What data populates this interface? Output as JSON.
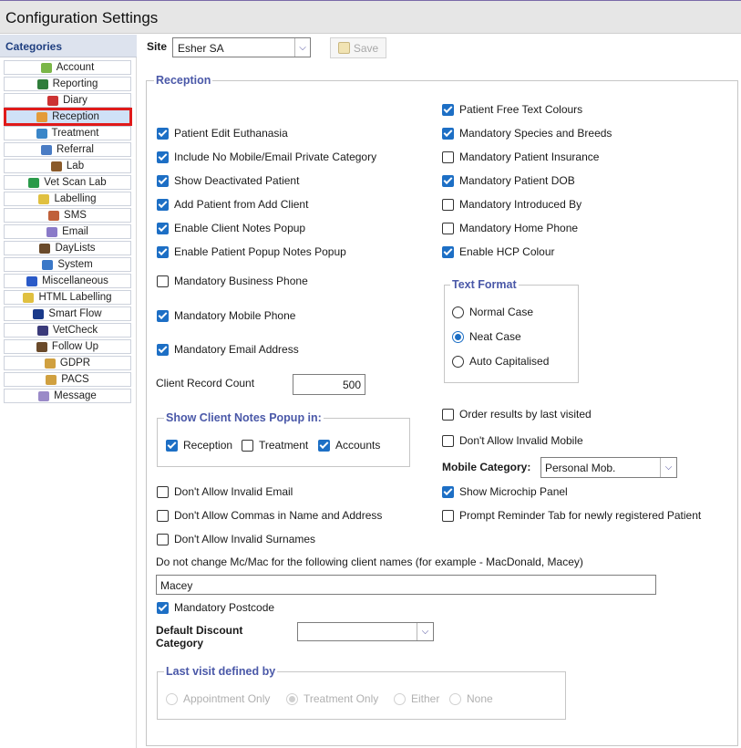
{
  "window": {
    "title": "Configuration Settings"
  },
  "sidebar": {
    "header": "Categories",
    "items": [
      {
        "label": "Account",
        "icon": "account-icon",
        "color": "#7ab648"
      },
      {
        "label": "Reporting",
        "icon": "reporting-icon",
        "color": "#2f7d3a"
      },
      {
        "label": "Diary",
        "icon": "diary-icon",
        "color": "#c33"
      },
      {
        "label": "Reception",
        "icon": "reception-icon",
        "color": "#e39b3a",
        "selected": true
      },
      {
        "label": "Treatment",
        "icon": "treatment-icon",
        "color": "#3a86c8"
      },
      {
        "label": "Referral",
        "icon": "referral-icon",
        "color": "#4a7cc4"
      },
      {
        "label": "Lab",
        "icon": "lab-icon",
        "color": "#8a5a2a"
      },
      {
        "label": "Vet Scan Lab",
        "icon": "vet-scan-lab-icon",
        "color": "#2a9a4a"
      },
      {
        "label": "Labelling",
        "icon": "labelling-icon",
        "color": "#e0c040"
      },
      {
        "label": "SMS",
        "icon": "sms-icon",
        "color": "#c0603a"
      },
      {
        "label": "Email",
        "icon": "email-icon",
        "color": "#8a7ac8"
      },
      {
        "label": "DayLists",
        "icon": "daylists-icon",
        "color": "#6a4a2a"
      },
      {
        "label": "System",
        "icon": "system-icon",
        "color": "#3a78c8"
      },
      {
        "label": "Miscellaneous",
        "icon": "miscellaneous-icon",
        "color": "#2a5ac8"
      },
      {
        "label": "HTML Labelling",
        "icon": "html-labelling-icon",
        "color": "#e0c040"
      },
      {
        "label": "Smart Flow",
        "icon": "smart-flow-icon",
        "color": "#1a3a8a"
      },
      {
        "label": "VetCheck",
        "icon": "vetcheck-icon",
        "color": "#3a3a7a"
      },
      {
        "label": "Follow Up",
        "icon": "follow-up-icon",
        "color": "#6a4a2a"
      },
      {
        "label": "GDPR",
        "icon": "gdpr-icon",
        "color": "#d0a040"
      },
      {
        "label": "PACS",
        "icon": "pacs-icon",
        "color": "#d0a040"
      },
      {
        "label": "Message",
        "icon": "message-icon",
        "color": "#9a8ac8"
      }
    ]
  },
  "toolbar": {
    "site_label": "Site",
    "site_value": "Esher SA",
    "save_label": "Save"
  },
  "reception": {
    "legend": "Reception",
    "left_checks": [
      {
        "label": "Patient Edit Euthanasia",
        "checked": true
      },
      {
        "label": "Include No Mobile/Email Private Category",
        "checked": true
      },
      {
        "label": "Show Deactivated Patient",
        "checked": true
      },
      {
        "label": "Add Patient from Add Client",
        "checked": true
      },
      {
        "label": "Enable Client Notes Popup",
        "checked": true
      },
      {
        "label": "Enable Patient Popup Notes Popup",
        "checked": true
      }
    ],
    "mandatory_business_phone": {
      "label": "Mandatory Business Phone",
      "checked": false
    },
    "mandatory_mobile_phone": {
      "label": "Mandatory Mobile Phone",
      "checked": true
    },
    "mandatory_email": {
      "label": "Mandatory Email Address",
      "checked": true
    },
    "right_checks": [
      {
        "label": "Patient Free Text Colours",
        "checked": true
      },
      {
        "label": "Mandatory Species and Breeds",
        "checked": true
      },
      {
        "label": "Mandatory Patient Insurance",
        "checked": false
      },
      {
        "label": "Mandatory Patient DOB",
        "checked": true
      },
      {
        "label": "Mandatory Introduced By",
        "checked": false
      },
      {
        "label": "Mandatory Home Phone",
        "checked": false
      },
      {
        "label": "Enable HCP Colour",
        "checked": true
      }
    ],
    "text_format": {
      "legend": "Text Format",
      "options": [
        {
          "label": "Normal Case",
          "selected": false
        },
        {
          "label": "Neat Case",
          "selected": true
        },
        {
          "label": "Auto Capitalised",
          "selected": false
        }
      ]
    },
    "client_record_count": {
      "label": "Client Record Count",
      "value": "500"
    },
    "client_notes_popup": {
      "legend": "Show Client Notes Popup in:",
      "options": [
        {
          "label": "Reception",
          "checked": true
        },
        {
          "label": "Treatment",
          "checked": false
        },
        {
          "label": "Accounts",
          "checked": true
        }
      ]
    },
    "order_results": {
      "label": "Order results by last visited",
      "checked": false
    },
    "dont_allow_invalid_mobile": {
      "label": "Don't Allow Invalid Mobile",
      "checked": false
    },
    "mobile_category": {
      "label": "Mobile Category:",
      "value": "Personal Mob."
    },
    "lower_left_checks": [
      {
        "label": "Don't Allow Invalid Email",
        "checked": false
      },
      {
        "label": "Don't Allow Commas in Name and Address",
        "checked": false
      },
      {
        "label": "Don't Allow Invalid Surnames",
        "checked": false
      }
    ],
    "lower_right_checks": [
      {
        "label": "Show Microchip Panel",
        "checked": true
      },
      {
        "label": "Prompt Reminder Tab for newly registered Patient",
        "checked": false
      }
    ],
    "mc_mac_label": "Do not change Mc/Mac for the following client names (for example - MacDonald, Macey)",
    "mc_mac_value": "Macey",
    "mandatory_postcode": {
      "label": "Mandatory Postcode",
      "checked": true
    },
    "default_discount": {
      "label_line1": "Default Discount",
      "label_line2": "Category",
      "value": ""
    },
    "last_visit": {
      "legend": "Last visit defined by",
      "options": [
        {
          "label": "Appointment Only",
          "selected": false
        },
        {
          "label": "Treatment Only",
          "selected": true
        },
        {
          "label": "Either",
          "selected": false
        },
        {
          "label": "None",
          "selected": false
        }
      ]
    }
  }
}
